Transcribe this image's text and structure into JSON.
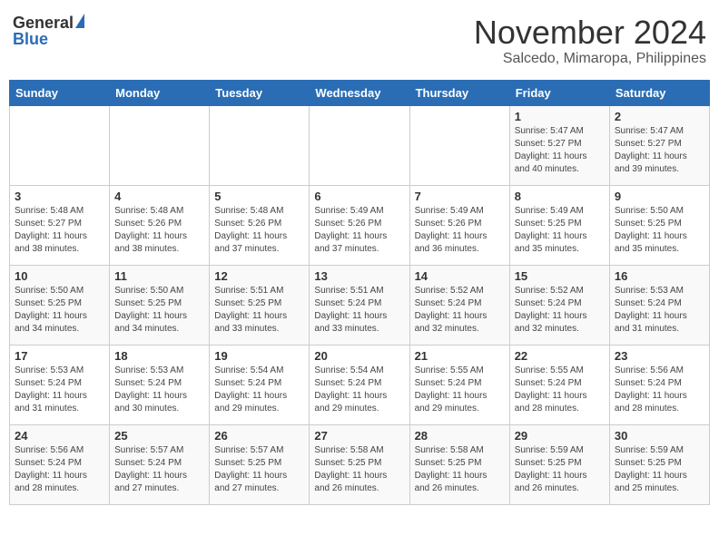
{
  "header": {
    "logo_general": "General",
    "logo_blue": "Blue",
    "month": "November 2024",
    "location": "Salcedo, Mimaropa, Philippines"
  },
  "days_of_week": [
    "Sunday",
    "Monday",
    "Tuesday",
    "Wednesday",
    "Thursday",
    "Friday",
    "Saturday"
  ],
  "weeks": [
    [
      {
        "day": "",
        "info": ""
      },
      {
        "day": "",
        "info": ""
      },
      {
        "day": "",
        "info": ""
      },
      {
        "day": "",
        "info": ""
      },
      {
        "day": "",
        "info": ""
      },
      {
        "day": "1",
        "info": "Sunrise: 5:47 AM\nSunset: 5:27 PM\nDaylight: 11 hours\nand 40 minutes."
      },
      {
        "day": "2",
        "info": "Sunrise: 5:47 AM\nSunset: 5:27 PM\nDaylight: 11 hours\nand 39 minutes."
      }
    ],
    [
      {
        "day": "3",
        "info": "Sunrise: 5:48 AM\nSunset: 5:27 PM\nDaylight: 11 hours\nand 38 minutes."
      },
      {
        "day": "4",
        "info": "Sunrise: 5:48 AM\nSunset: 5:26 PM\nDaylight: 11 hours\nand 38 minutes."
      },
      {
        "day": "5",
        "info": "Sunrise: 5:48 AM\nSunset: 5:26 PM\nDaylight: 11 hours\nand 37 minutes."
      },
      {
        "day": "6",
        "info": "Sunrise: 5:49 AM\nSunset: 5:26 PM\nDaylight: 11 hours\nand 37 minutes."
      },
      {
        "day": "7",
        "info": "Sunrise: 5:49 AM\nSunset: 5:26 PM\nDaylight: 11 hours\nand 36 minutes."
      },
      {
        "day": "8",
        "info": "Sunrise: 5:49 AM\nSunset: 5:25 PM\nDaylight: 11 hours\nand 35 minutes."
      },
      {
        "day": "9",
        "info": "Sunrise: 5:50 AM\nSunset: 5:25 PM\nDaylight: 11 hours\nand 35 minutes."
      }
    ],
    [
      {
        "day": "10",
        "info": "Sunrise: 5:50 AM\nSunset: 5:25 PM\nDaylight: 11 hours\nand 34 minutes."
      },
      {
        "day": "11",
        "info": "Sunrise: 5:50 AM\nSunset: 5:25 PM\nDaylight: 11 hours\nand 34 minutes."
      },
      {
        "day": "12",
        "info": "Sunrise: 5:51 AM\nSunset: 5:25 PM\nDaylight: 11 hours\nand 33 minutes."
      },
      {
        "day": "13",
        "info": "Sunrise: 5:51 AM\nSunset: 5:24 PM\nDaylight: 11 hours\nand 33 minutes."
      },
      {
        "day": "14",
        "info": "Sunrise: 5:52 AM\nSunset: 5:24 PM\nDaylight: 11 hours\nand 32 minutes."
      },
      {
        "day": "15",
        "info": "Sunrise: 5:52 AM\nSunset: 5:24 PM\nDaylight: 11 hours\nand 32 minutes."
      },
      {
        "day": "16",
        "info": "Sunrise: 5:53 AM\nSunset: 5:24 PM\nDaylight: 11 hours\nand 31 minutes."
      }
    ],
    [
      {
        "day": "17",
        "info": "Sunrise: 5:53 AM\nSunset: 5:24 PM\nDaylight: 11 hours\nand 31 minutes."
      },
      {
        "day": "18",
        "info": "Sunrise: 5:53 AM\nSunset: 5:24 PM\nDaylight: 11 hours\nand 30 minutes."
      },
      {
        "day": "19",
        "info": "Sunrise: 5:54 AM\nSunset: 5:24 PM\nDaylight: 11 hours\nand 29 minutes."
      },
      {
        "day": "20",
        "info": "Sunrise: 5:54 AM\nSunset: 5:24 PM\nDaylight: 11 hours\nand 29 minutes."
      },
      {
        "day": "21",
        "info": "Sunrise: 5:55 AM\nSunset: 5:24 PM\nDaylight: 11 hours\nand 29 minutes."
      },
      {
        "day": "22",
        "info": "Sunrise: 5:55 AM\nSunset: 5:24 PM\nDaylight: 11 hours\nand 28 minutes."
      },
      {
        "day": "23",
        "info": "Sunrise: 5:56 AM\nSunset: 5:24 PM\nDaylight: 11 hours\nand 28 minutes."
      }
    ],
    [
      {
        "day": "24",
        "info": "Sunrise: 5:56 AM\nSunset: 5:24 PM\nDaylight: 11 hours\nand 28 minutes."
      },
      {
        "day": "25",
        "info": "Sunrise: 5:57 AM\nSunset: 5:24 PM\nDaylight: 11 hours\nand 27 minutes."
      },
      {
        "day": "26",
        "info": "Sunrise: 5:57 AM\nSunset: 5:25 PM\nDaylight: 11 hours\nand 27 minutes."
      },
      {
        "day": "27",
        "info": "Sunrise: 5:58 AM\nSunset: 5:25 PM\nDaylight: 11 hours\nand 26 minutes."
      },
      {
        "day": "28",
        "info": "Sunrise: 5:58 AM\nSunset: 5:25 PM\nDaylight: 11 hours\nand 26 minutes."
      },
      {
        "day": "29",
        "info": "Sunrise: 5:59 AM\nSunset: 5:25 PM\nDaylight: 11 hours\nand 26 minutes."
      },
      {
        "day": "30",
        "info": "Sunrise: 5:59 AM\nSunset: 5:25 PM\nDaylight: 11 hours\nand 25 minutes."
      }
    ]
  ]
}
